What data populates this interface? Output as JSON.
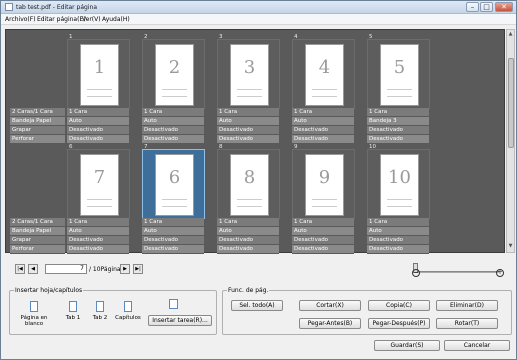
{
  "window": {
    "title": "tab test.pdf - Editar página"
  },
  "menu": [
    "Archivo(F)",
    "Editar página(E)",
    "Ver(V)",
    "Ayuda(H)"
  ],
  "attr_labels": [
    "2 Caras/1 Cara",
    "Bandeja Papel",
    "Grapar",
    "Perforar"
  ],
  "rows": [
    {
      "pages": [
        {
          "num": "1",
          "big": "1",
          "vals": [
            "1 Cara",
            "Auto",
            "Desactivado",
            "Desactivado"
          ]
        },
        {
          "num": "2",
          "big": "2",
          "vals": [
            "1 Cara",
            "Auto",
            "Desactivado",
            "Desactivado"
          ]
        },
        {
          "num": "3",
          "big": "3",
          "vals": [
            "1 Cara",
            "Auto",
            "Desactivado",
            "Desactivado"
          ]
        },
        {
          "num": "4",
          "big": "4",
          "vals": [
            "1 Cara",
            "Auto",
            "Desactivado",
            "Desactivado"
          ]
        },
        {
          "num": "5",
          "big": "5",
          "vals": [
            "1 Cara",
            "Bandeja 3",
            "Desactivado",
            "Desactivado"
          ]
        }
      ]
    },
    {
      "pages": [
        {
          "num": "6",
          "big": "7",
          "vals": [
            "1 Cara",
            "Auto",
            "Desactivado",
            "Desactivado"
          ]
        },
        {
          "num": "7",
          "big": "6",
          "vals": [
            "1 Cara",
            "Auto",
            "Desactivado",
            "Desactivado"
          ],
          "selected": true
        },
        {
          "num": "8",
          "big": "8",
          "vals": [
            "1 Cara",
            "Auto",
            "Desactivado",
            "Desactivado"
          ]
        },
        {
          "num": "9",
          "big": "9",
          "vals": [
            "1 Cara",
            "Auto",
            "Desactivado",
            "Desactivado"
          ]
        },
        {
          "num": "10",
          "big": "10",
          "vals": [
            "1 Cara",
            "Auto",
            "Desactivado",
            "Desactivado"
          ]
        }
      ]
    }
  ],
  "pager": {
    "current": "7",
    "total_text": "/ 10Página"
  },
  "insert_group": {
    "title": "Insertar hoja/capítulos",
    "items": [
      "Página en blanco",
      "Tab 1",
      "Tab 2",
      "Capítulos"
    ],
    "insert_tab_label": "Insertar tarea(R)..."
  },
  "func_group": {
    "title": "Func. de pág.",
    "buttons_row1": [
      "Sel. todo(A)",
      "Cortar(X)",
      "Copia(C)",
      "Eliminar(D)"
    ],
    "buttons_row2": [
      "Pegar-Antes(B)",
      "Pegar-Después(P)",
      "Rotar(T)"
    ]
  },
  "footer": {
    "save": "Guardar(S)",
    "cancel": "Cancelar"
  },
  "colors": {
    "selected_page": "#3e6f9a",
    "panel_bg": "#5a5a5a"
  }
}
